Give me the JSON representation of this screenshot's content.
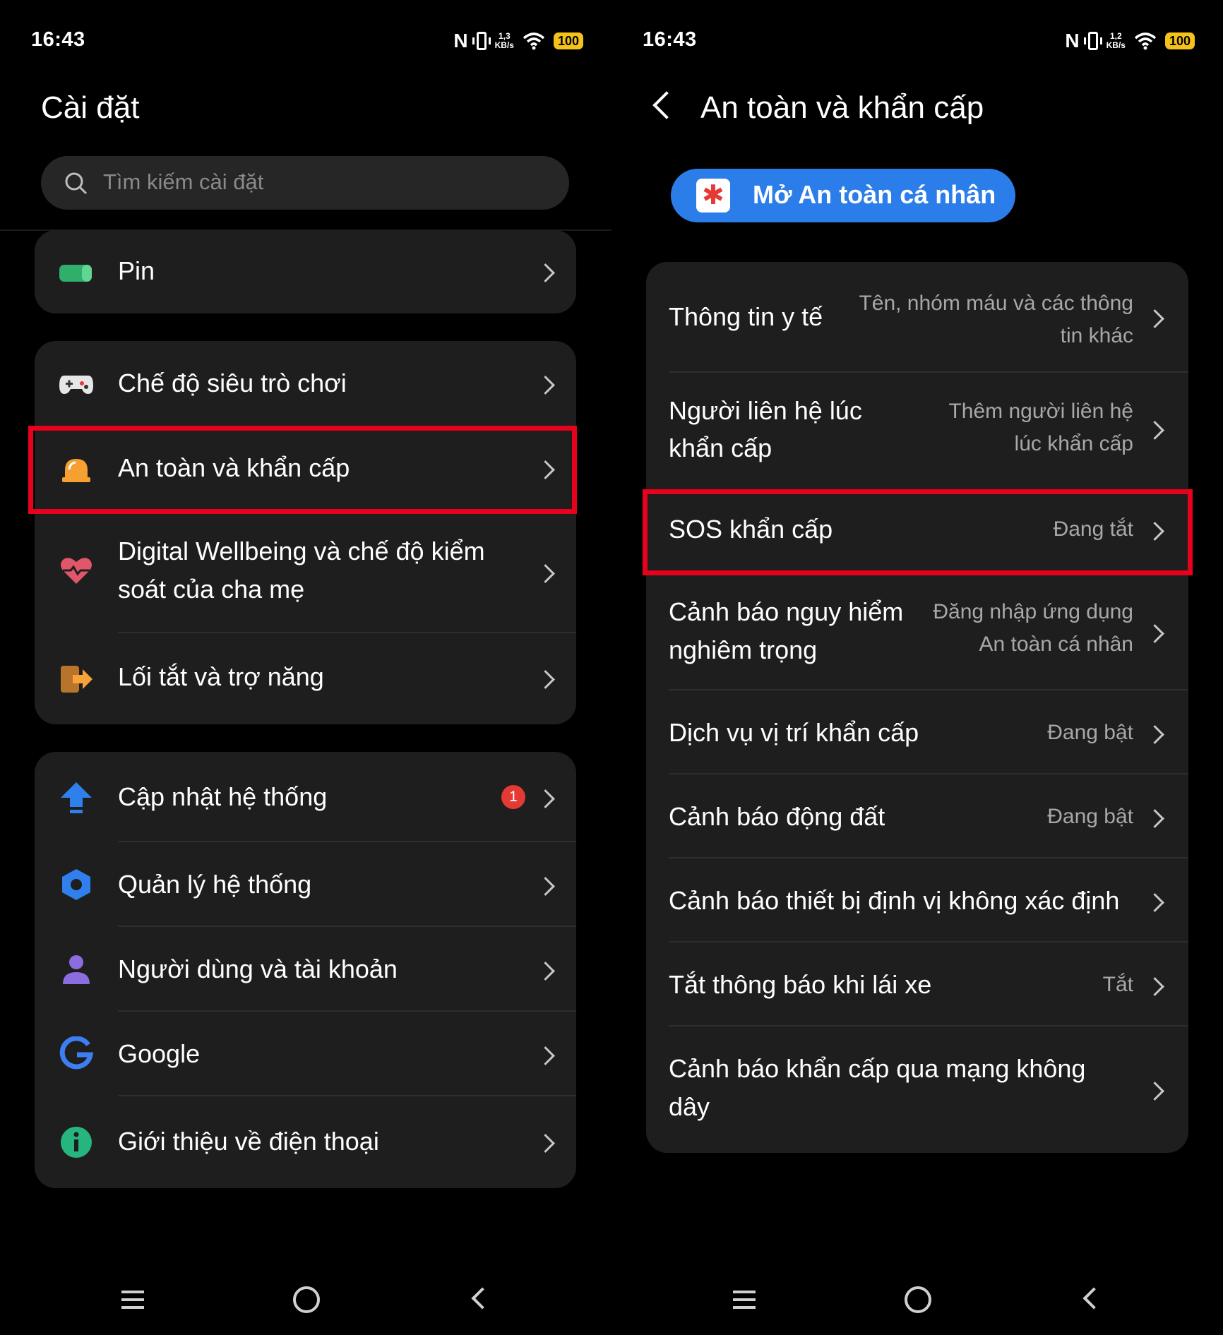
{
  "status_left": {
    "time": "16:43",
    "nfc": "N",
    "net_speed": "1,3",
    "net_unit": "KB/s",
    "battery": "100"
  },
  "status_right": {
    "time": "16:43",
    "nfc": "N",
    "net_speed": "1,2",
    "net_unit": "KB/s",
    "battery": "100"
  },
  "settings": {
    "title": "Cài đặt",
    "search_placeholder": "Tìm kiếm cài đặt",
    "group1": [
      {
        "label": "Pin",
        "icon": "battery-icon"
      }
    ],
    "group2": [
      {
        "label": "Chế độ siêu trò chơi",
        "icon": "gamepad-icon"
      },
      {
        "label": "An toàn và khẩn cấp",
        "icon": "alarm-icon"
      },
      {
        "label": "Digital Wellbeing và chế độ kiểm",
        "label2": "soát của cha mẹ",
        "icon": "heart-icon"
      },
      {
        "label": "Lối tắt và trợ năng",
        "icon": "shortcut-icon"
      }
    ],
    "group3": [
      {
        "label": "Cập nhật hệ thống",
        "icon": "update-arrow-icon",
        "badge": "1"
      },
      {
        "label": "Quản lý hệ thống",
        "icon": "hexagon-icon"
      },
      {
        "label": "Người dùng và tài khoản",
        "icon": "user-icon"
      },
      {
        "label": "Google",
        "icon": "google-icon"
      },
      {
        "label": "Giới thiệu về điện thoại",
        "icon": "info-icon"
      }
    ]
  },
  "safety": {
    "title": "An toàn và khẩn cấp",
    "open_button": "Mở An toàn cá nhân",
    "items": [
      {
        "label": "Thông tin y tế",
        "value": "Tên, nhóm máu và các thông",
        "value2": "tin khác"
      },
      {
        "label": "Người liên hệ lúc",
        "label2": "khẩn cấp",
        "value": "Thêm người liên hệ",
        "value2": "lúc khẩn cấp"
      },
      {
        "label": "SOS khẩn cấp",
        "value": "Đang tắt"
      },
      {
        "label": "Cảnh báo nguy hiểm",
        "label2": "nghiêm trọng",
        "value": "Đăng nhập ứng dụng",
        "value2": "An toàn cá nhân"
      },
      {
        "label": "Dịch vụ vị trí khẩn cấp",
        "value": "Đang bật"
      },
      {
        "label": "Cảnh báo động đất",
        "value": "Đang bật"
      },
      {
        "label": "Cảnh báo thiết bị định vị không xác định"
      },
      {
        "label": "Tắt thông báo khi lái xe",
        "value": "Tắt"
      },
      {
        "label": "Cảnh báo khẩn cấp qua mạng không",
        "label2": "dây"
      }
    ]
  },
  "colors": {
    "highlight": "#e8001c",
    "accent_blue": "#2b7de9",
    "card": "#1e1e1e",
    "badge": "#e53935"
  }
}
